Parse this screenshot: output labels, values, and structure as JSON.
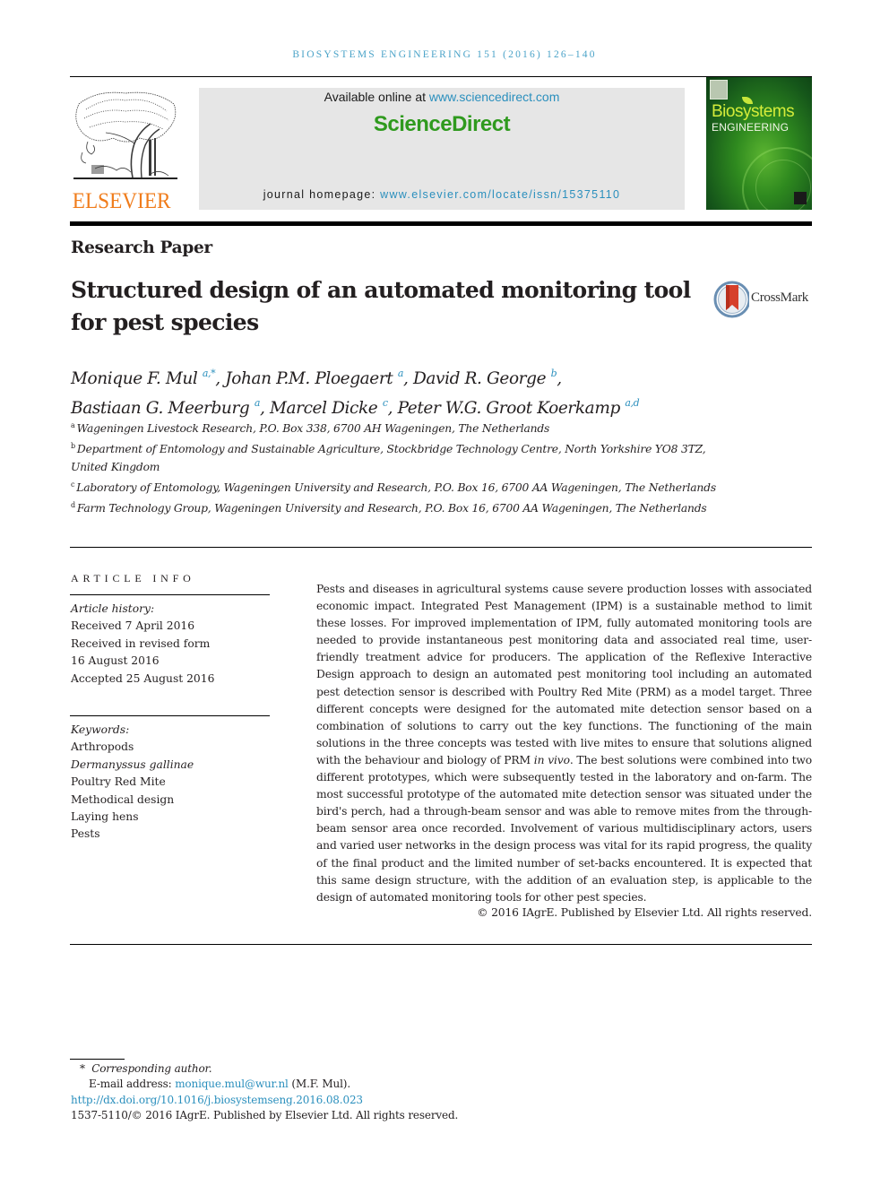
{
  "running_header": "BIOSYSTEMS ENGINEERING 151 (2016) 126–140",
  "masthead": {
    "publisher_logo_word": "ELSEVIER",
    "available_prefix": "Available online at ",
    "available_link": "www.sciencedirect.com",
    "sciencedirect_logo": "ScienceDirect",
    "homepage_prefix": "journal homepage: ",
    "homepage_link": "www.elsevier.com/locate/issn/15375110",
    "journal_cover": {
      "title_line1": "Biosystems",
      "title_line2": "ENGINEERING",
      "accent_color": "#d4ec3a",
      "background_color": "#2f8a1f"
    }
  },
  "article": {
    "type": "Research Paper",
    "title": "Structured design of an automated monitoring tool for pest species",
    "crossmark_label": "CrossMark",
    "authors": [
      {
        "name": "Monique F. Mul",
        "affiliations": "a,*",
        "separator": ", "
      },
      {
        "name": "Johan P.M. Ploegaert",
        "affiliations": "a",
        "separator": ", "
      },
      {
        "name": "David R. George",
        "affiliations": "b",
        "separator": ","
      },
      {
        "name": "Bastiaan G. Meerburg",
        "affiliations": "a",
        "separator": ", "
      },
      {
        "name": "Marcel Dicke",
        "affiliations": "c",
        "separator": ", "
      },
      {
        "name": "Peter W.G. Groot Koerkamp",
        "affiliations": "a,d",
        "separator": ""
      }
    ],
    "affiliations": [
      {
        "key": "a",
        "text": "Wageningen Livestock Research, P.O. Box 338, 6700 AH Wageningen, The Netherlands"
      },
      {
        "key": "b",
        "text": "Department of Entomology and Sustainable Agriculture, Stockbridge Technology Centre, North Yorkshire YO8 3TZ, United Kingdom"
      },
      {
        "key": "c",
        "text": "Laboratory of Entomology, Wageningen University and Research, P.O. Box 16, 6700 AA Wageningen, The Netherlands"
      },
      {
        "key": "d",
        "text": "Farm Technology Group, Wageningen University and Research, P.O. Box 16, 6700 AA Wageningen, The Netherlands"
      }
    ]
  },
  "article_info": {
    "heading": "ARTICLE INFO",
    "history_label": "Article history:",
    "history": [
      "Received 7 April 2016",
      "Received in revised form",
      "16 August 2016",
      "Accepted 25 August 2016"
    ],
    "keywords_label": "Keywords:",
    "keywords": [
      {
        "text": "Arthropods",
        "italic": false
      },
      {
        "text": "Dermanyssus gallinae",
        "italic": true
      },
      {
        "text": "Poultry Red Mite",
        "italic": false
      },
      {
        "text": "Methodical design",
        "italic": false
      },
      {
        "text": "Laying hens",
        "italic": false
      },
      {
        "text": "Pests",
        "italic": false
      }
    ]
  },
  "abstract": {
    "part1": "Pests and diseases in agricultural systems cause severe production losses with associated economic impact. Integrated Pest Management (IPM) is a sustainable method to limit these losses. For improved implementation of IPM, fully automated monitoring tools are needed to provide instantaneous pest monitoring data and associated real time, user-friendly treatment advice for producers. The application of the Reflexive Interactive Design approach to design an automated pest monitoring tool including an automated pest detection sensor is described with Poultry Red Mite (PRM) as a model target. Three different concepts were designed for the automated mite detection sensor based on a combination of solutions to carry out the key functions. The functioning of the main solutions in the three concepts was tested with live mites to ensure that solutions aligned with the behaviour and biology of PRM ",
    "italic_phrase": "in vivo",
    "part2": ". The best solutions were combined into two different prototypes, which were subsequently tested in the laboratory and on-farm. The most successful prototype of the automated mite detection sensor was situated under the bird's perch, had a through-beam sensor and was able to remove mites from the through-beam sensor area once recorded. Involvement of various multidisciplinary actors, users and varied user networks in the design process was vital for its rapid progress, the quality of the final product and the limited number of set-backs encountered. It is expected that this same design structure, with the addition of an evaluation step, is applicable to the design of automated monitoring tools for other pest species.",
    "copyright": "© 2016 IAgrE. Published by Elsevier Ltd. All rights reserved."
  },
  "footnotes": {
    "corresponding_mark": "*",
    "corresponding_label": "Corresponding author.",
    "email_prefix": "E-mail address: ",
    "email_link": "monique.mul@wur.nl",
    "email_suffix": " (M.F. Mul).",
    "doi_link": "http://dx.doi.org/10.1016/j.biosystemseng.2016.08.023",
    "issn_line": "1537-5110/© 2016 IAgrE. Published by Elsevier Ltd. All rights reserved."
  }
}
